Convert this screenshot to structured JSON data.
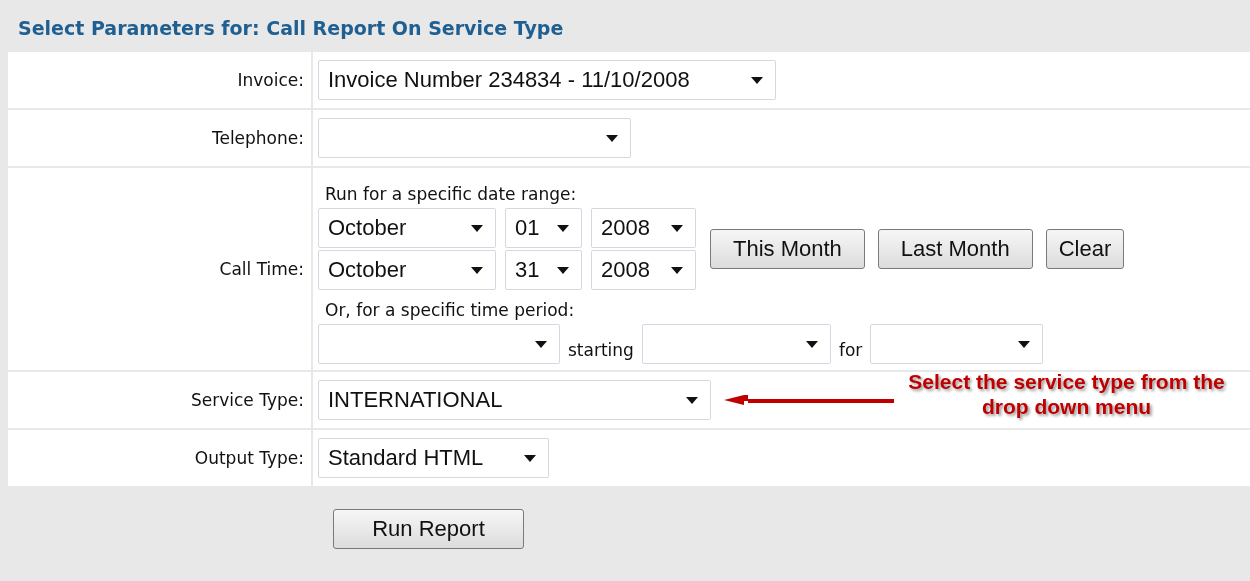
{
  "title": "Select Parameters for: Call Report On Service Type",
  "fields": [
    {
      "kind": "select",
      "label": "Invoice:",
      "value": "Invoice Number 234834 - 11/10/2008"
    },
    {
      "kind": "select",
      "label": "Telephone:"
    },
    {
      "kind": "call_time",
      "label": "Call Time:",
      "range_label": "Run for a specific date range:",
      "start": [
        "October",
        "01",
        "2008"
      ],
      "end": [
        "October",
        "31",
        "2008"
      ],
      "buttons": [
        "This Month",
        "Last Month",
        "Clear"
      ],
      "period_label": "Or, for a specific time period:",
      "period_words": [
        "starting",
        "for"
      ]
    },
    {
      "kind": "select",
      "label": "Service Type:",
      "value": "INTERNATIONAL",
      "annotation": "Select the service type from the drop down menu"
    },
    {
      "kind": "select",
      "label": "Output Type:",
      "value": "Standard HTML"
    }
  ],
  "run_button": "Run Report"
}
